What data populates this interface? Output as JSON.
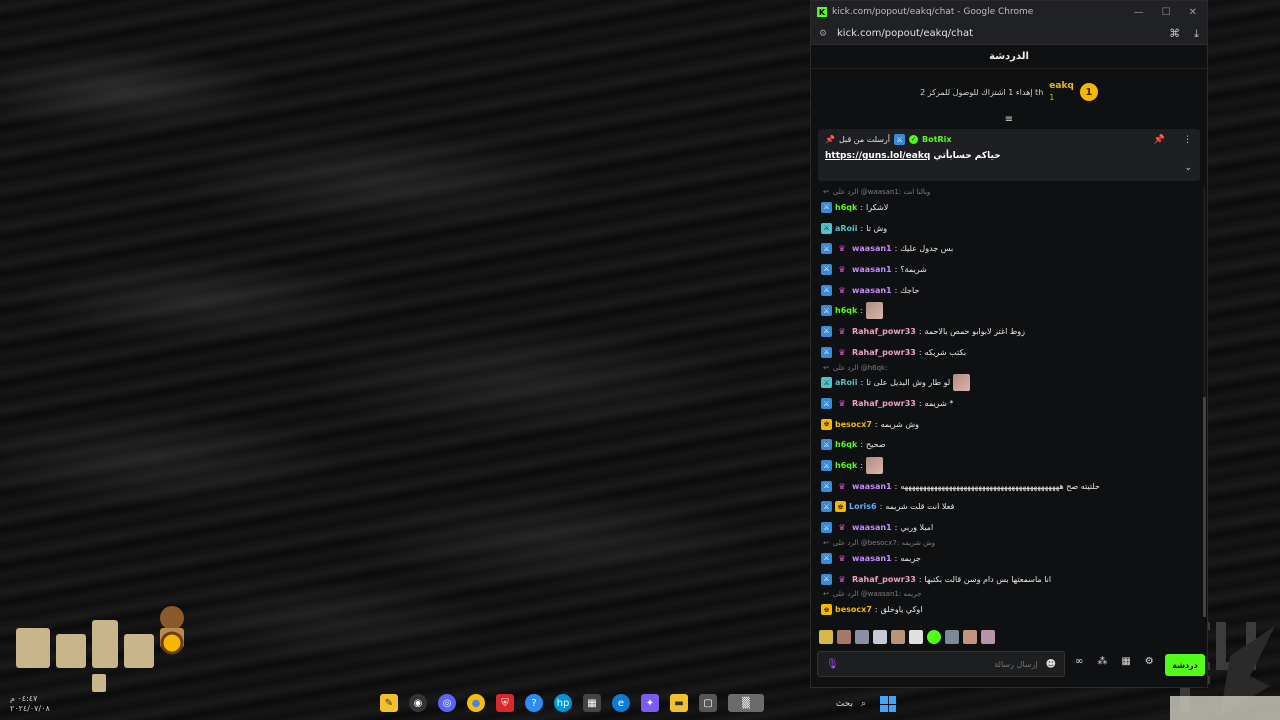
{
  "window": {
    "title": "kick.com/popout/eakq/chat - Google Chrome",
    "url": "kick.com/popout/eakq/chat",
    "controls": [
      "—",
      "☐",
      "✕"
    ]
  },
  "chat": {
    "header": "الدردشة",
    "goal": {
      "coin": "1",
      "user": "eakq",
      "user_count": "1",
      "text": "إهداء 1 اشتراك للوصول للمركز 2 th"
    },
    "pinned": {
      "by_label": "أرسلت من قبل",
      "bot": "BotRix",
      "message": "حياكم حسابأتي",
      "link": "https://guns.lol/eakq"
    },
    "messages": [
      {
        "reply": "الرد على @waasan1: وبالنا انت"
      },
      {
        "badges": [
          "blue"
        ],
        "user": "h6qk",
        "color": "#53fc18",
        "text": "لاشكرا"
      },
      {
        "badges": [
          "teal"
        ],
        "user": "aRoii",
        "color": "#4fc3c7",
        "text": "وش تا"
      },
      {
        "badges": [
          "blue",
          "vip"
        ],
        "user": "waasan1",
        "color": "#c68cff",
        "text": "بس جدول عليك"
      },
      {
        "badges": [
          "blue",
          "vip"
        ],
        "user": "waasan1",
        "color": "#c68cff",
        "text": "شريمة؟"
      },
      {
        "badges": [
          "blue",
          "vip"
        ],
        "user": "waasan1",
        "color": "#c68cff",
        "text": "حاجك"
      },
      {
        "badges": [
          "blue"
        ],
        "user": "h6qk",
        "color": "#53fc18",
        "text": "",
        "emote": true
      },
      {
        "badges": [
          "blue",
          "vip"
        ],
        "user": "Rahaf_powr33",
        "color": "#f0a0c8",
        "text": "زوط اغتر لابوابو حمص بالاحمة"
      },
      {
        "badges": [
          "blue",
          "vip"
        ],
        "user": "Rahaf_powr33",
        "color": "#f0a0c8",
        "text": "بكتب شريكه"
      },
      {
        "reply": "الرد على @h6qk:"
      },
      {
        "badges": [
          "teal"
        ],
        "user": "aRoii",
        "color": "#4fc3c7",
        "text": "لو طار وش البديل على تا",
        "emote": true
      },
      {
        "badges": [
          "blue",
          "vip"
        ],
        "user": "Rahaf_powr33",
        "color": "#f0a0c8",
        "text": "شريمه *"
      },
      {
        "badges": [
          "gold"
        ],
        "user": "besocx7",
        "color": "#f5b800",
        "text": "وش شريمه"
      },
      {
        "badges": [
          "blue"
        ],
        "user": "h6qk",
        "color": "#53fc18",
        "text": "صحيح"
      },
      {
        "badges": [
          "blue"
        ],
        "user": "h6qk",
        "color": "#53fc18",
        "text": "",
        "emote": true
      },
      {
        "badges": [
          "blue",
          "vip"
        ],
        "user": "waasan1",
        "color": "#c68cff",
        "text": "حلتيته صح هههههههههههههههههههههههههههههههههههههههههههه"
      },
      {
        "badges": [
          "blue",
          "gold"
        ],
        "user": "Loris6",
        "color": "#5ab0ff",
        "text": "فعلا انت قلت شريمه"
      },
      {
        "badges": [
          "blue",
          "vip"
        ],
        "user": "waasan1",
        "color": "#c68cff",
        "text": "امبلا وربي"
      },
      {
        "reply": "الرد على @besocx7: وش شريمه"
      },
      {
        "badges": [
          "blue",
          "vip"
        ],
        "user": "waasan1",
        "color": "#c68cff",
        "text": "جريمه"
      },
      {
        "badges": [
          "blue",
          "vip"
        ],
        "user": "Rahaf_powr33",
        "color": "#f0a0c8",
        "text": "انا ماسمعتها بس دام وسن قالت بكتبها"
      },
      {
        "reply": "الرد على @waasan1: جريمه"
      },
      {
        "badges": [
          "gold"
        ],
        "user": "besocx7",
        "color": "#f5b800",
        "text": "اوكي ياوخلق"
      }
    ],
    "input_placeholder": "إرسال رسالة",
    "send_label": "دردشة"
  },
  "desktop": {
    "clock_time": "٠٤:٤٧ م",
    "clock_date": "٢٠٢٤/٠٧/٠٨",
    "search_label": "بحث"
  },
  "colors": {
    "kick_green": "#53fc18",
    "bg": "#0f1012"
  }
}
